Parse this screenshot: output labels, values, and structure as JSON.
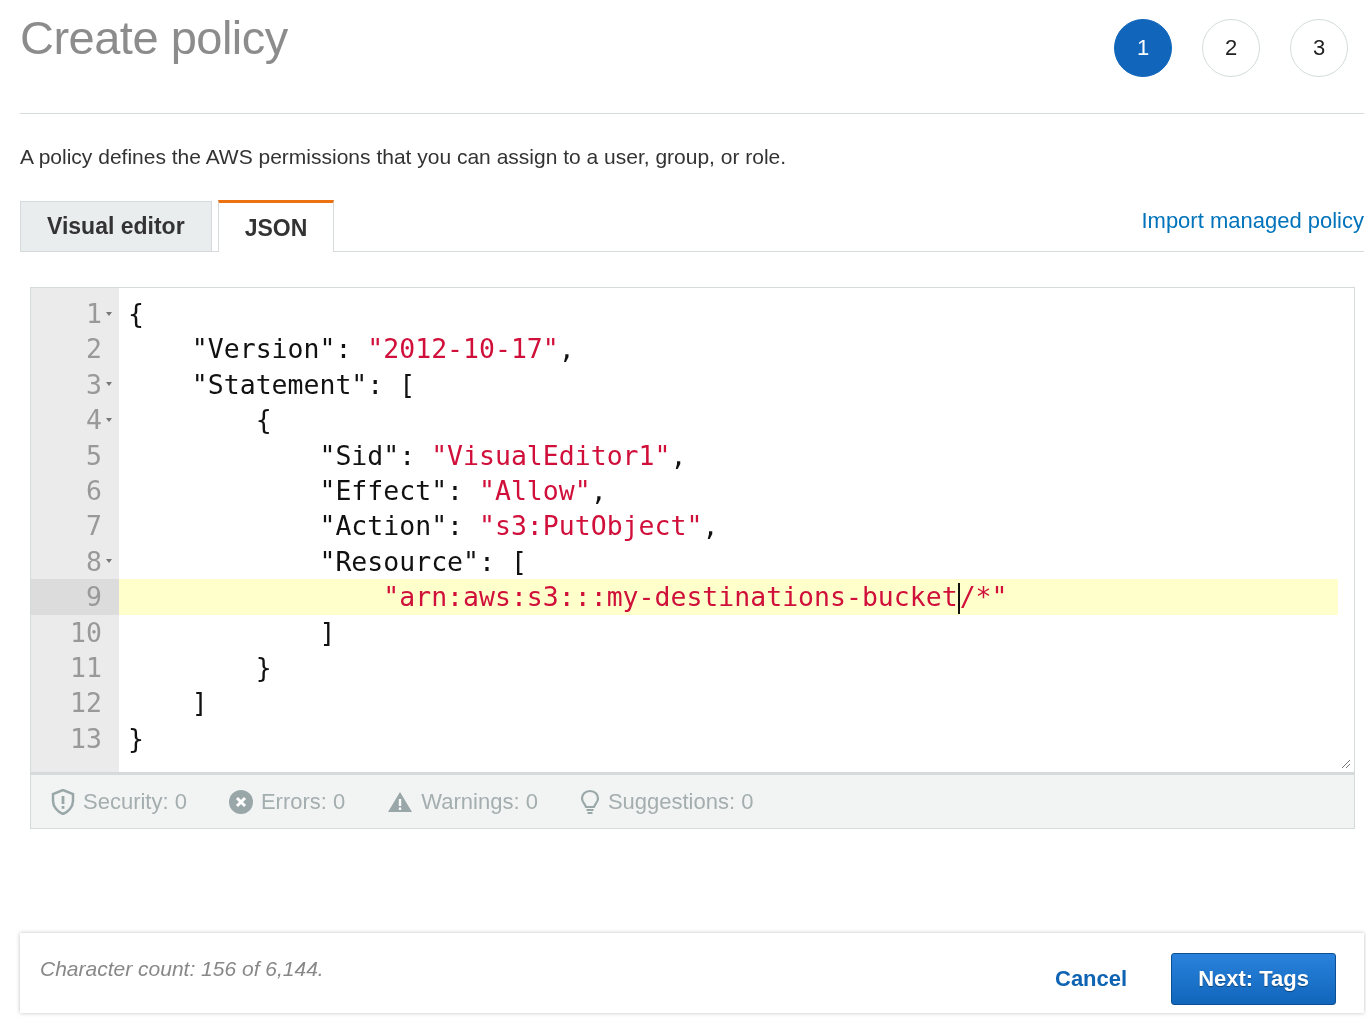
{
  "title": "Create policy",
  "steps": [
    {
      "label": "1",
      "selected": true
    },
    {
      "label": "2",
      "selected": false
    },
    {
      "label": "3",
      "selected": false
    }
  ],
  "description": "A policy defines the AWS permissions that you can assign to a user, group, or role.",
  "tabs": [
    {
      "label": "Visual editor",
      "selected": false
    },
    {
      "label": "JSON",
      "selected": true
    }
  ],
  "import_link": "Import managed policy",
  "editor": {
    "lines": [
      {
        "number": "1",
        "foldable": true,
        "active": false,
        "tokens": [
          {
            "kind": "plain",
            "text": "{"
          }
        ]
      },
      {
        "number": "2",
        "foldable": false,
        "active": false,
        "tokens": [
          {
            "kind": "plain",
            "text": "    \"Version\": "
          },
          {
            "kind": "string",
            "text": "\"2012-10-17\""
          },
          {
            "kind": "plain",
            "text": ","
          }
        ]
      },
      {
        "number": "3",
        "foldable": true,
        "active": false,
        "tokens": [
          {
            "kind": "plain",
            "text": "    \"Statement\": ["
          }
        ]
      },
      {
        "number": "4",
        "foldable": true,
        "active": false,
        "tokens": [
          {
            "kind": "plain",
            "text": "        {"
          }
        ]
      },
      {
        "number": "5",
        "foldable": false,
        "active": false,
        "tokens": [
          {
            "kind": "plain",
            "text": "            \"Sid\": "
          },
          {
            "kind": "string",
            "text": "\"VisualEditor1\""
          },
          {
            "kind": "plain",
            "text": ","
          }
        ]
      },
      {
        "number": "6",
        "foldable": false,
        "active": false,
        "tokens": [
          {
            "kind": "plain",
            "text": "            \"Effect\": "
          },
          {
            "kind": "string",
            "text": "\"Allow\""
          },
          {
            "kind": "plain",
            "text": ","
          }
        ]
      },
      {
        "number": "7",
        "foldable": false,
        "active": false,
        "tokens": [
          {
            "kind": "plain",
            "text": "            \"Action\": "
          },
          {
            "kind": "string",
            "text": "\"s3:PutObject\""
          },
          {
            "kind": "plain",
            "text": ","
          }
        ]
      },
      {
        "number": "8",
        "foldable": true,
        "active": false,
        "tokens": [
          {
            "kind": "plain",
            "text": "            \"Resource\": ["
          }
        ]
      },
      {
        "number": "9",
        "foldable": false,
        "active": true,
        "tokens": [
          {
            "kind": "string",
            "text": "                \"arn:aws:s3:::my-destinations-bucket"
          },
          {
            "kind": "cursor"
          },
          {
            "kind": "string",
            "text": "/*\""
          }
        ]
      },
      {
        "number": "10",
        "foldable": false,
        "active": false,
        "tokens": [
          {
            "kind": "plain",
            "text": "            ]"
          }
        ]
      },
      {
        "number": "11",
        "foldable": false,
        "active": false,
        "tokens": [
          {
            "kind": "plain",
            "text": "        }"
          }
        ]
      },
      {
        "number": "12",
        "foldable": false,
        "active": false,
        "tokens": [
          {
            "kind": "plain",
            "text": "    ]"
          }
        ]
      },
      {
        "number": "13",
        "foldable": false,
        "active": false,
        "tokens": [
          {
            "kind": "plain",
            "text": "}"
          }
        ]
      }
    ]
  },
  "checks": [
    {
      "kind": "security",
      "label": "Security: 0"
    },
    {
      "kind": "errors",
      "label": "Errors: 0"
    },
    {
      "kind": "warnings",
      "label": "Warnings: 0"
    },
    {
      "kind": "suggestions",
      "label": "Suggestions: 0"
    }
  ],
  "character_count": "Character count: 156 of 6,144.",
  "buttons": [
    {
      "kind": "link",
      "label": "Cancel"
    },
    {
      "kind": "primary",
      "label": "Next: Tags"
    }
  ]
}
